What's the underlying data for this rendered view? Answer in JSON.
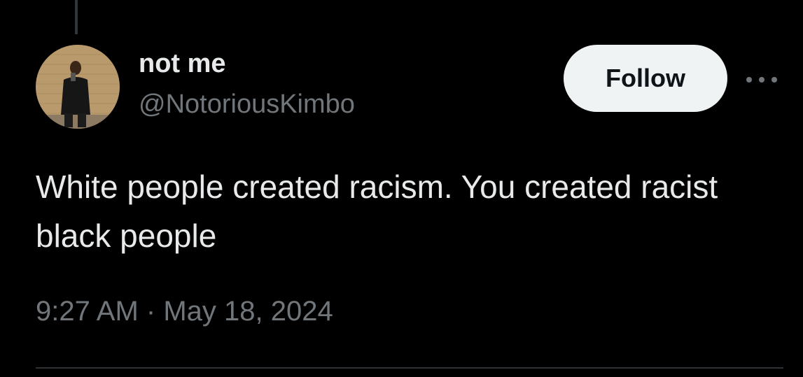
{
  "tweet": {
    "author": {
      "display_name": "not me",
      "handle": "@NotoriousKimbo"
    },
    "follow_label": "Follow",
    "text": "White people created racism. You created racist black people",
    "time": "9:27 AM",
    "separator": "·",
    "date": "May 18, 2024"
  },
  "icons": {
    "more": "more-horizontal-icon"
  },
  "colors": {
    "background": "#000000",
    "primary_text": "#e7e9ea",
    "secondary_text": "#71767b",
    "follow_button_bg": "#eff3f4",
    "follow_button_text": "#0f1419",
    "divider": "#2f3336"
  }
}
